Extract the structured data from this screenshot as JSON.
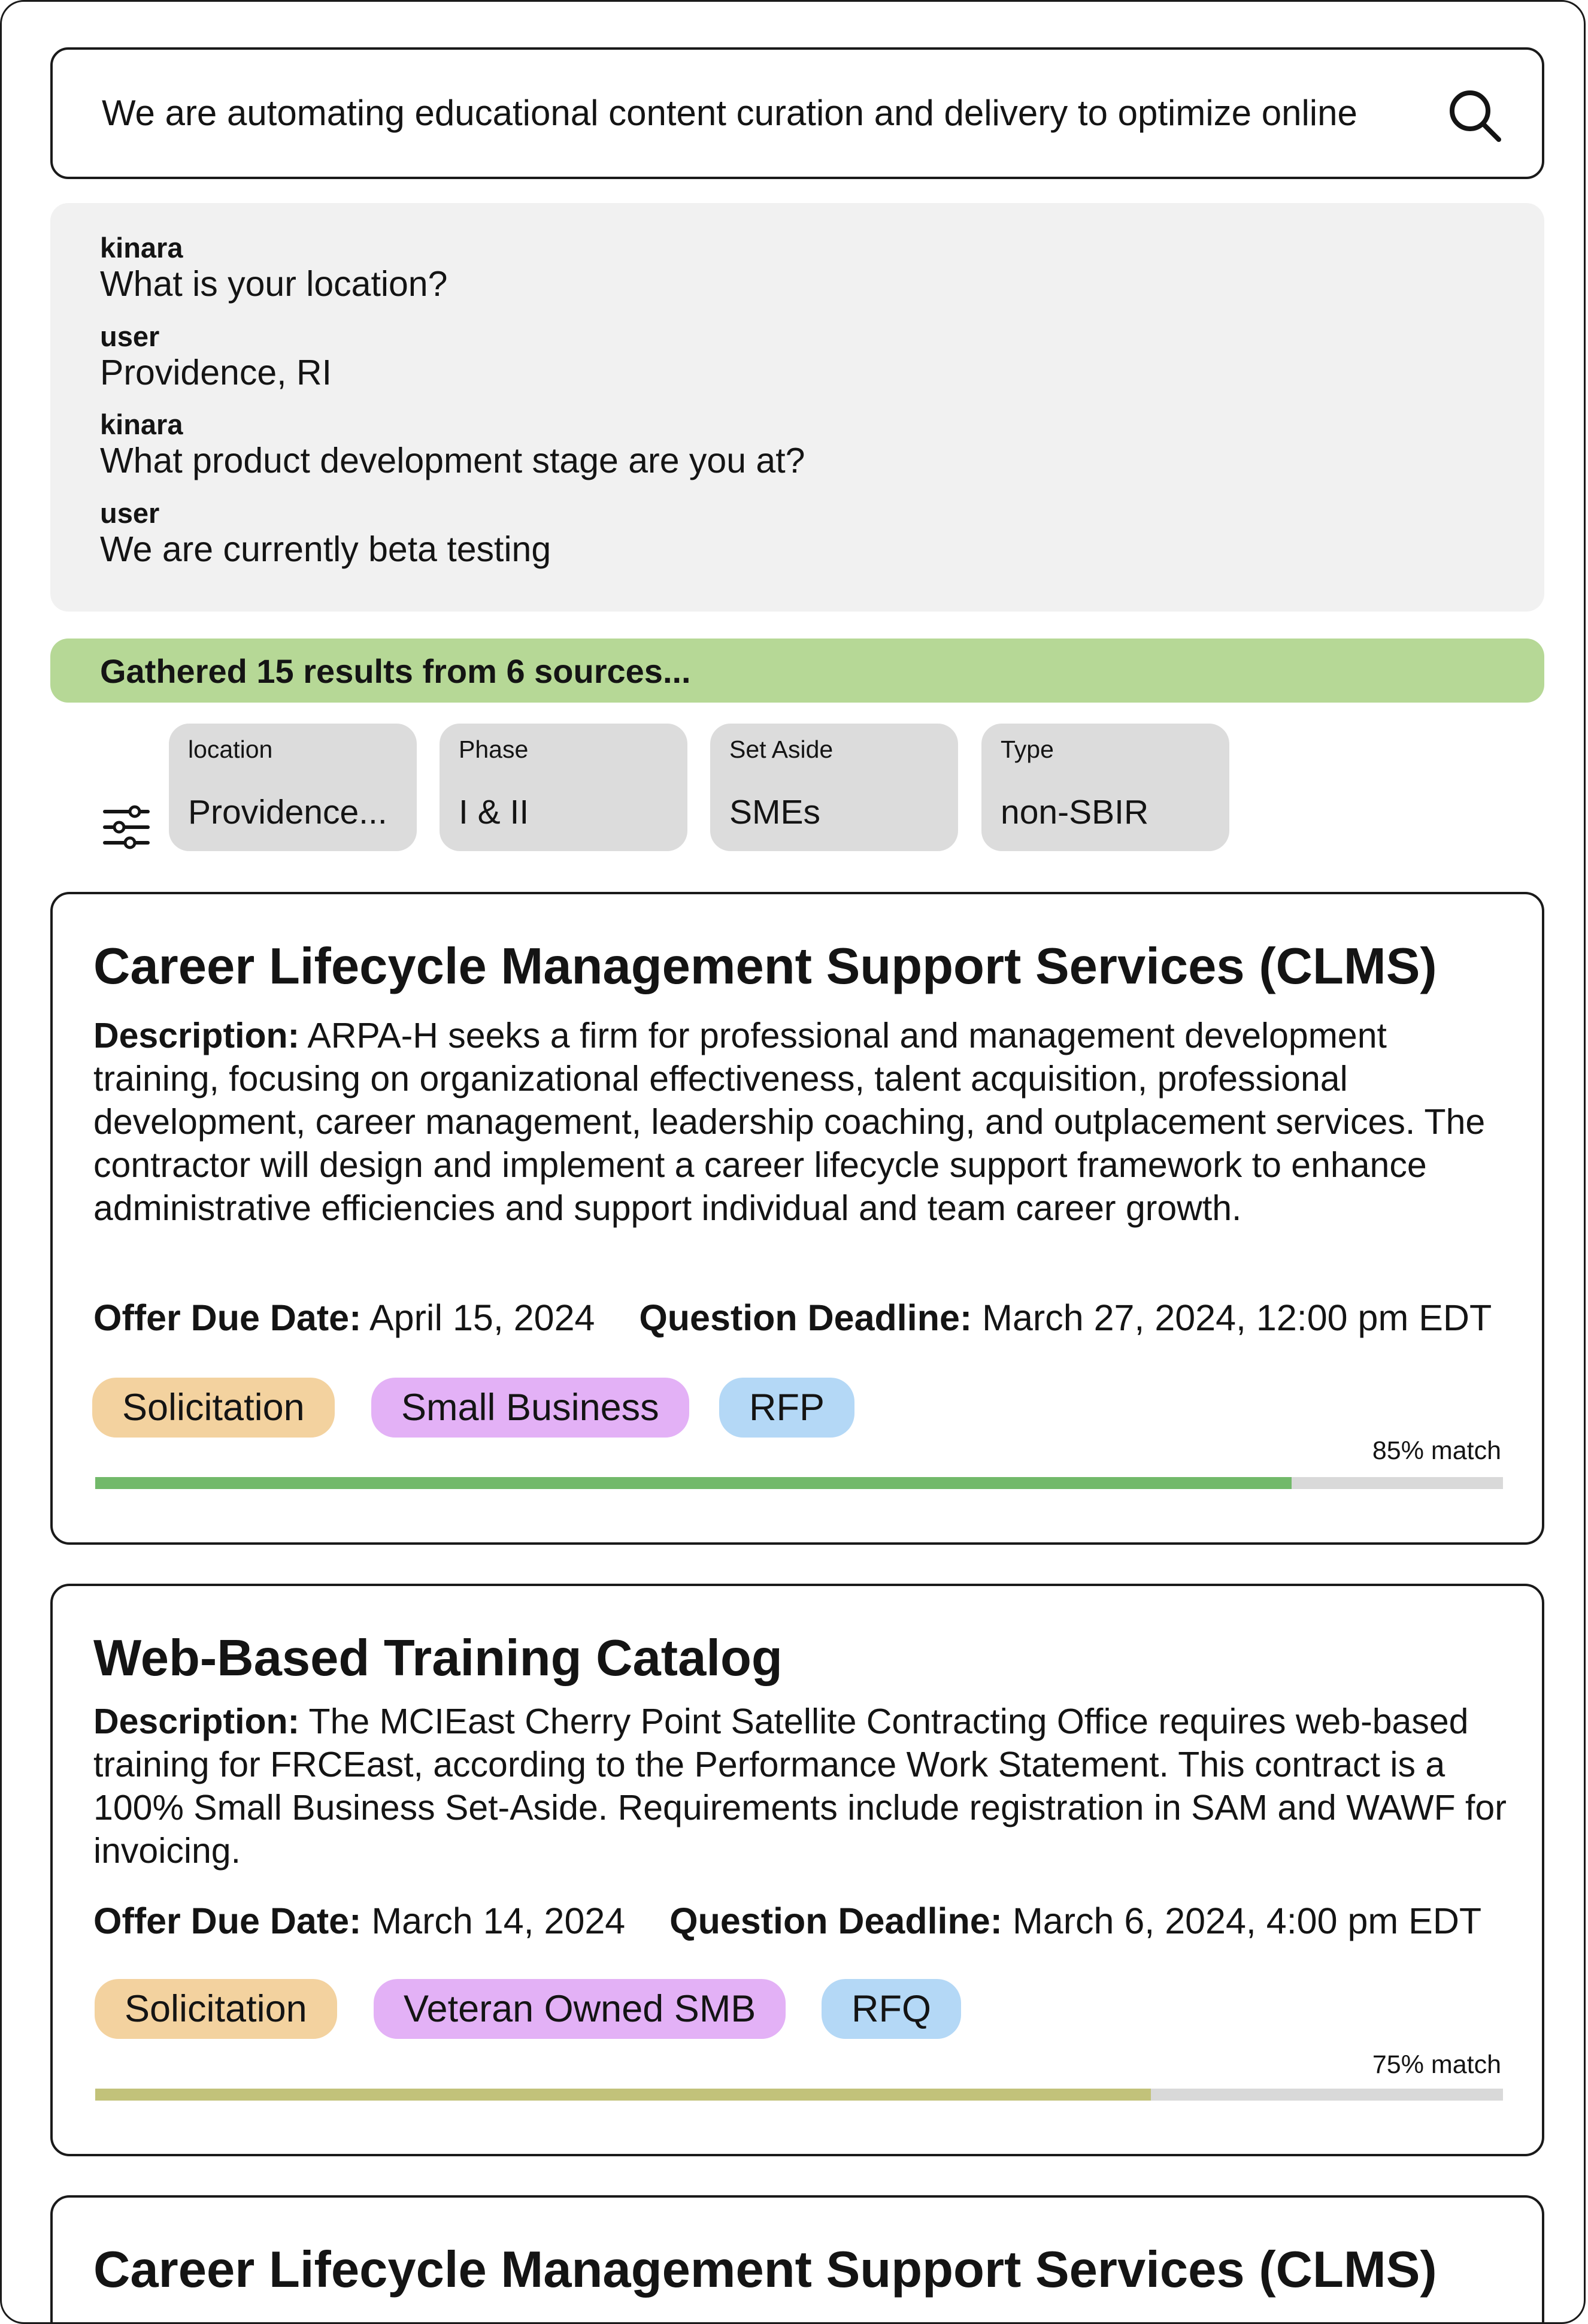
{
  "search": {
    "query": "We are automating educational content curation and delivery to optimize online"
  },
  "chat": [
    {
      "role": "kinara",
      "message": "What is your location?"
    },
    {
      "role": "user",
      "message": "Providence, RI"
    },
    {
      "role": "kinara",
      "message": "What product development stage are you at?"
    },
    {
      "role": "user",
      "message": "We are currently beta testing"
    }
  ],
  "status": {
    "text": "Gathered 15 results from 6 sources...",
    "color": "#b6d896"
  },
  "filters": [
    {
      "label": "location",
      "value": "Providence..."
    },
    {
      "label": "Phase",
      "value": "I & II"
    },
    {
      "label": "Set Aside",
      "value": "SMEs"
    },
    {
      "label": "Type",
      "value": "non-SBIR"
    }
  ],
  "labels": {
    "description": "Description:",
    "offer_due": "Offer Due Date:",
    "question_deadline": "Question Deadline:"
  },
  "results": [
    {
      "title": "Career Lifecycle Management Support Services (CLMS)",
      "description": "ARPA-H seeks a firm for professional and management development training, focusing on organizational effectiveness, talent acquisition, professional development, career management, leadership coaching, and outplacement services. The contractor will design and implement a career lifecycle support framework to enhance administrative efficiencies and support individual and team career growth.",
      "offer_due_date": "April 15, 2024",
      "question_deadline": "March 27, 2024, 12:00 pm EDT",
      "tags": [
        "Solicitation",
        "Small Business",
        "RFP"
      ],
      "match_label": "85% match",
      "match": 0.85,
      "match_color": "#72b96a"
    },
    {
      "title": "Web-Based Training Catalog",
      "description": "The MCIEast Cherry Point Satellite Contracting Office requires web-based training for FRCEast, according to the Performance Work Statement. This contract is a 100% Small Business Set-Aside. Requirements include registration in SAM and WAWF for invoicing.",
      "offer_due_date": "March 14, 2024",
      "question_deadline": "March 6, 2024, 4:00 pm EDT",
      "tags": [
        "Solicitation",
        "Veteran Owned SMB",
        "RFQ"
      ],
      "match_label": "75% match",
      "match": 0.75,
      "match_color": "#c2c27a"
    },
    {
      "title": "Career Lifecycle Management Support Services (CLMS)"
    }
  ],
  "colors": {
    "tag_status": "#f3d29f",
    "tag_business": "#e3b1f6",
    "tag_type": "#b4d8f6",
    "chat_bg": "#f1f1f1",
    "filter_bg": "#dcdcdc"
  },
  "icons": {
    "search": "search-icon",
    "filter": "sliders-icon"
  }
}
